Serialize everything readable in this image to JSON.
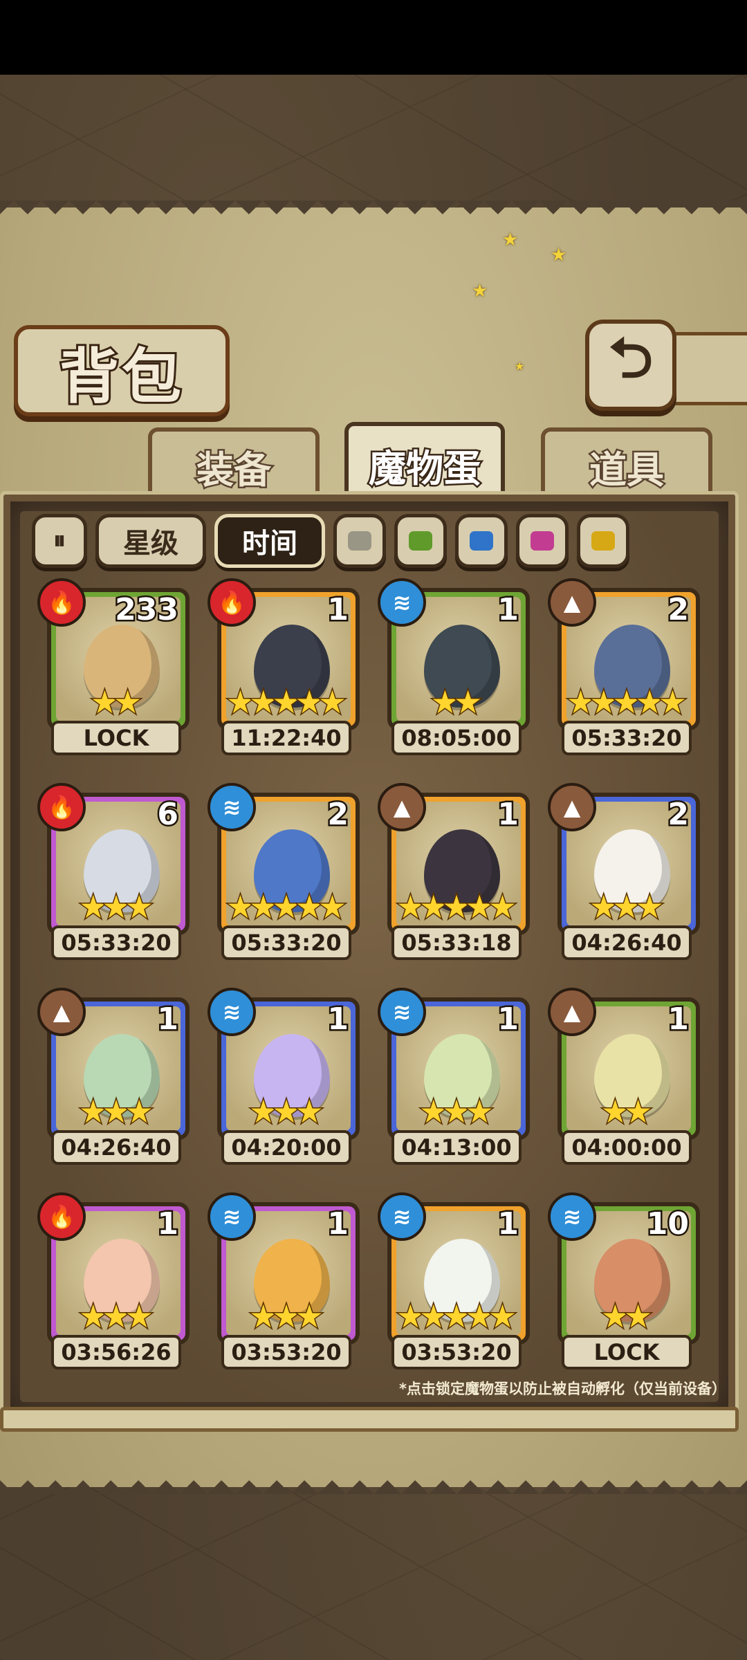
{
  "header": {
    "title": "背包",
    "back_icon": "back-arrow-icon"
  },
  "tabs": [
    {
      "label": "装备",
      "active": false
    },
    {
      "label": "魔物蛋",
      "active": true
    },
    {
      "label": "道具",
      "active": false
    }
  ],
  "filters": {
    "sort_icon": "sort-toggle-icon",
    "sort_glyph": "⏸",
    "star_label": "星级",
    "time_label": "时间",
    "color_filters": [
      {
        "name": "gray",
        "color": "#9a9686"
      },
      {
        "name": "green",
        "color": "#5f9a2a"
      },
      {
        "name": "blue",
        "color": "#2f74c8"
      },
      {
        "name": "pink",
        "color": "#c23d92"
      },
      {
        "name": "yellow",
        "color": "#d7a816"
      }
    ]
  },
  "eggs": [
    {
      "element": "fire",
      "count": "233",
      "stars": 2,
      "rarity": "green",
      "label": "LOCK",
      "color": "#d9b57a"
    },
    {
      "element": "fire",
      "count": "1",
      "stars": 5,
      "rarity": "gold",
      "label": "11:22:40",
      "color": "#3b3f4c"
    },
    {
      "element": "water",
      "count": "1",
      "stars": 2,
      "rarity": "green",
      "label": "08:05:00",
      "color": "#3f4a52"
    },
    {
      "element": "earth",
      "count": "2",
      "stars": 5,
      "rarity": "gold",
      "label": "05:33:20",
      "color": "#5a6f98"
    },
    {
      "element": "fire",
      "count": "6",
      "stars": 3,
      "rarity": "purple",
      "label": "05:33:20",
      "color": "#d6dbe4"
    },
    {
      "element": "water",
      "count": "2",
      "stars": 5,
      "rarity": "gold",
      "label": "05:33:20",
      "color": "#4f78c8"
    },
    {
      "element": "earth",
      "count": "1",
      "stars": 5,
      "rarity": "gold",
      "label": "05:33:18",
      "color": "#3c3540"
    },
    {
      "element": "earth",
      "count": "2",
      "stars": 3,
      "rarity": "blue",
      "label": "04:26:40",
      "color": "#f5f2ec"
    },
    {
      "element": "earth",
      "count": "1",
      "stars": 3,
      "rarity": "blue",
      "label": "04:26:40",
      "color": "#b9d8b4"
    },
    {
      "element": "water",
      "count": "1",
      "stars": 3,
      "rarity": "blue",
      "label": "04:20:00",
      "color": "#c7b5f2"
    },
    {
      "element": "water",
      "count": "1",
      "stars": 3,
      "rarity": "blue",
      "label": "04:13:00",
      "color": "#d7e6b0"
    },
    {
      "element": "earth",
      "count": "1",
      "stars": 2,
      "rarity": "green",
      "label": "04:00:00",
      "color": "#e9e2a6"
    },
    {
      "element": "fire",
      "count": "1",
      "stars": 3,
      "rarity": "purple",
      "label": "03:56:26",
      "color": "#f3c6ad"
    },
    {
      "element": "water",
      "count": "1",
      "stars": 3,
      "rarity": "purple",
      "label": "03:53:20",
      "color": "#f0b24a"
    },
    {
      "element": "water",
      "count": "1",
      "stars": 5,
      "rarity": "gold",
      "label": "03:53:20",
      "color": "#f2f4ee"
    },
    {
      "element": "water",
      "count": "10",
      "stars": 2,
      "rarity": "green",
      "label": "LOCK",
      "color": "#d88e66"
    }
  ],
  "footer_note": "*点击锁定魔物蛋以防止被自动孵化（仅当前设备）",
  "element_icons": {
    "fire": "🔥",
    "water": "≋",
    "earth": "▲"
  }
}
